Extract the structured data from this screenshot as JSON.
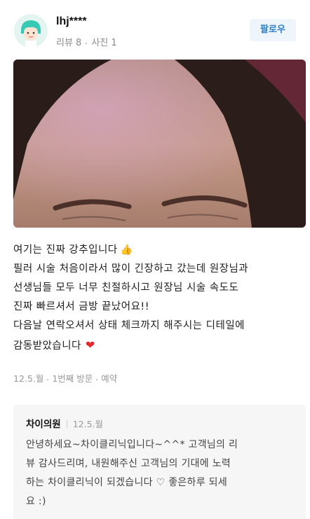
{
  "user": {
    "name": "lhj****",
    "review_count": "리뷰 8",
    "photo_count": "사진 1"
  },
  "follow_button": "팔로우",
  "review": {
    "lines": [
      "여기는 진짜 강추입니다",
      "필러 시술 처음이라서 많이 긴장하고 갔는데 원장님과",
      "선생님들 모두 너무 친절하시고 원장님 시술 속도도",
      "진짜 빠르셔서 금방 끝났어요!!",
      "다음날 연락오셔서 상태 체크까지 해주시는 디테일에",
      "감동받았습니다"
    ],
    "emoji": [
      "thumbs-up",
      "heart"
    ]
  },
  "visit": {
    "date": "12.5.월",
    "visit_count": "1번째 방문",
    "type": "예약"
  },
  "owner_reply": {
    "name": "차이의원",
    "date": "12.5.월",
    "lines": [
      "안녕하세요~차이클리닉입니다~^^* 고객님의 리",
      "뷰 감사드리며, 내원해주신 고객님의 기대에 노력",
      "하는 차이클리닉이 되겠습니다 ♡ 좋은하루 되세",
      "요 :)"
    ]
  },
  "colors": {
    "accent": "#2f7fc7",
    "heart": "#e8262d",
    "muted": "#999999",
    "reply_bg": "#f6f6f6"
  }
}
